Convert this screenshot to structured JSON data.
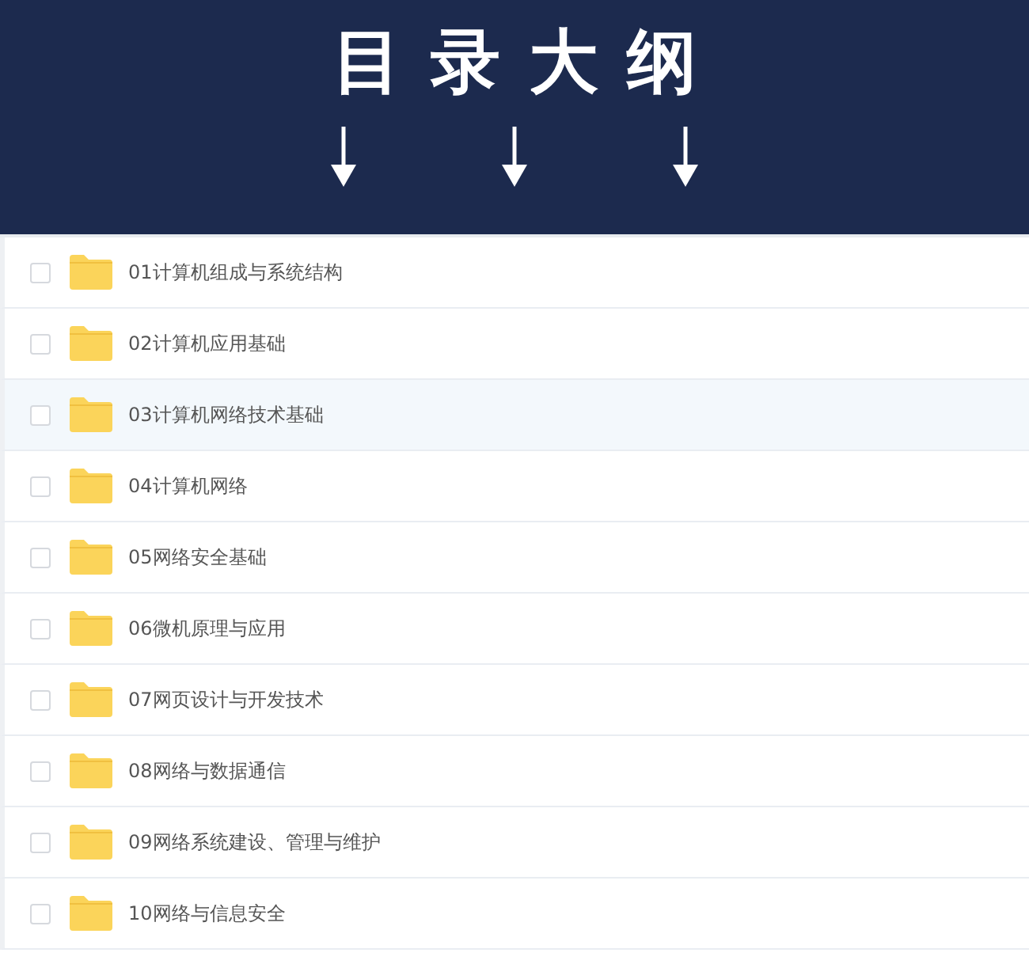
{
  "banner": {
    "title": "目录大纲"
  },
  "folders": [
    {
      "name": "01计算机组成与系统结构",
      "checked": false,
      "highlighted": false
    },
    {
      "name": "02计算机应用基础",
      "checked": false,
      "highlighted": false
    },
    {
      "name": "03计算机网络技术基础",
      "checked": false,
      "highlighted": true
    },
    {
      "name": "04计算机网络",
      "checked": false,
      "highlighted": false
    },
    {
      "name": "05网络安全基础",
      "checked": false,
      "highlighted": false
    },
    {
      "name": "06微机原理与应用",
      "checked": false,
      "highlighted": false
    },
    {
      "name": "07网页设计与开发技术",
      "checked": false,
      "highlighted": false
    },
    {
      "name": "08网络与数据通信",
      "checked": false,
      "highlighted": false
    },
    {
      "name": "09网络系统建设、管理与维护",
      "checked": false,
      "highlighted": false
    },
    {
      "name": "10网络与信息安全",
      "checked": false,
      "highlighted": false
    }
  ]
}
